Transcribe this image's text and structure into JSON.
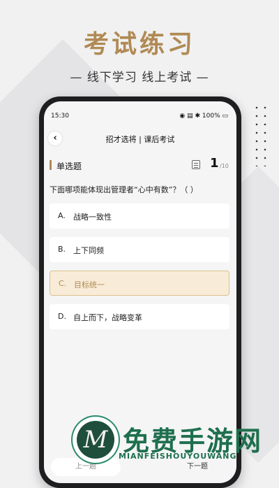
{
  "hero": {
    "title": "考试练习",
    "subtitle": "— 线下学习  线上考试 —"
  },
  "status_bar": {
    "time": "15:30",
    "icons": "◉ ▤ ✱ 100% ▭",
    "battery": "100%"
  },
  "nav": {
    "back_icon": "‹",
    "title": "招才选将  |  课后考试"
  },
  "question": {
    "type": "单选题",
    "current": "1",
    "total": "/10",
    "text": "下面哪项能体现出管理者“心中有数”？（      ）",
    "options": [
      {
        "letter": "A.",
        "text": "战略一致性",
        "selected": false
      },
      {
        "letter": "B.",
        "text": "上下同频",
        "selected": false
      },
      {
        "letter": "C.",
        "text": "目标统一",
        "selected": true
      },
      {
        "letter": "D.",
        "text": "自上而下，战略变革",
        "selected": false
      }
    ]
  },
  "footer": {
    "prev_label": "上一题",
    "next_label": "下一题"
  },
  "watermark": {
    "logo_letter": "M",
    "title": "免费手游网",
    "subtitle": "MIANFEISHOUYOUWANG"
  },
  "colors": {
    "accent": "#b08a54",
    "selected_bg": "#f8ecd8",
    "watermark_green": "#1e6f4e"
  }
}
